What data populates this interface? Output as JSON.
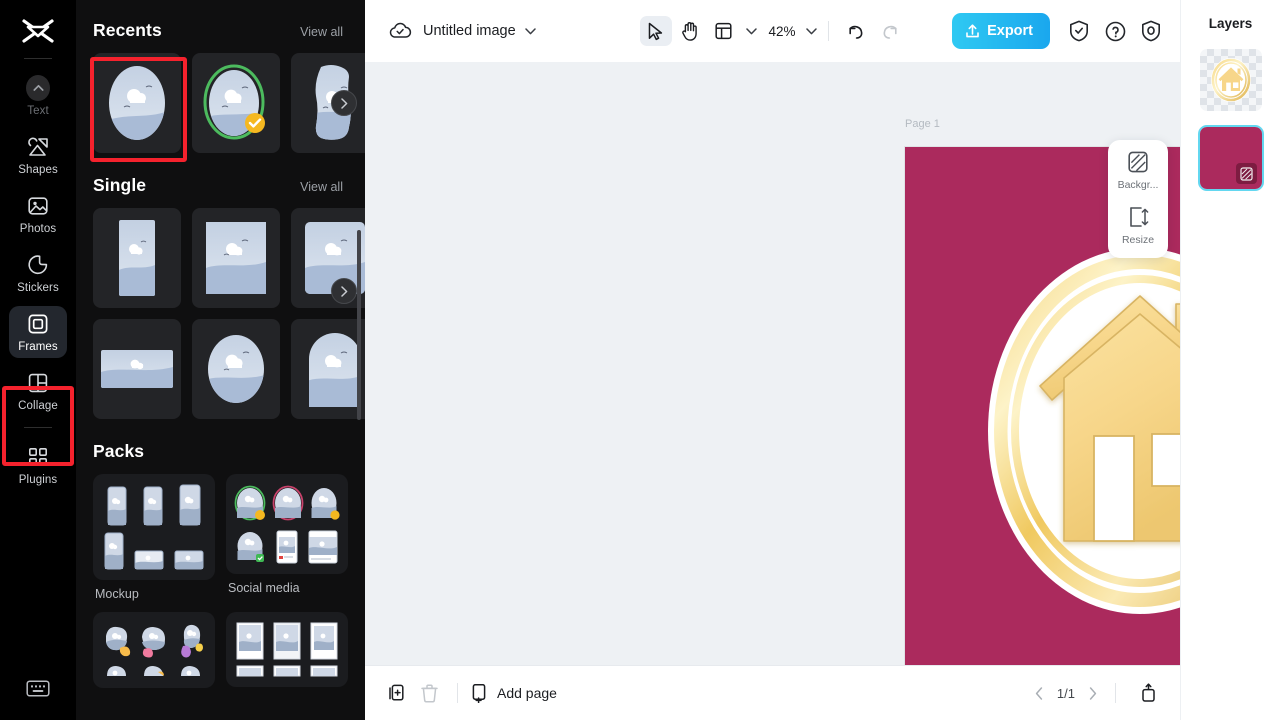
{
  "app": {
    "name": "CapCut",
    "logo_icon": "capcut-logo-icon"
  },
  "sidebar": {
    "items": [
      {
        "label": "Text",
        "icon": "chevron-up-circle-icon",
        "active": false,
        "dim": true
      },
      {
        "label": "Shapes",
        "icon": "shapes-icon",
        "active": false,
        "dim": false
      },
      {
        "label": "Photos",
        "icon": "photo-icon",
        "active": false,
        "dim": false
      },
      {
        "label": "Stickers",
        "icon": "sticker-icon",
        "active": false,
        "dim": false
      },
      {
        "label": "Frames",
        "icon": "frame-icon",
        "active": true,
        "dim": false
      },
      {
        "label": "Collage",
        "icon": "collage-icon",
        "active": false,
        "dim": false
      },
      {
        "label": "Plugins",
        "icon": "plugins-grid-icon",
        "active": false,
        "dim": false
      }
    ],
    "keyboard_icon": "keyboard-icon",
    "highlight_color": "#f5222d"
  },
  "panel": {
    "sections": [
      {
        "title": "Recents",
        "view_all": "View all"
      },
      {
        "title": "Single",
        "view_all": "View all"
      },
      {
        "title": "Packs",
        "view_all": ""
      }
    ],
    "recents": [
      {
        "name": "oval-frame",
        "selected": true,
        "shape": "oval",
        "badge": "none"
      },
      {
        "name": "green-ring-oval-frame",
        "selected": false,
        "shape": "oval",
        "badge": "check",
        "ring": "#4cbb5e",
        "badge_color": "#f5b820"
      },
      {
        "name": "torn-paper-frame",
        "selected": false,
        "shape": "torn",
        "badge": "none"
      }
    ],
    "single": [
      {
        "name": "tall-rect-frame",
        "shape": "tall-rect"
      },
      {
        "name": "wide-rect-frame",
        "shape": "rect"
      },
      {
        "name": "rounded-rect-frame",
        "shape": "rounded-rect"
      },
      {
        "name": "landscape-frame",
        "shape": "landscape"
      },
      {
        "name": "circle-frame",
        "shape": "circle"
      },
      {
        "name": "arch-frame",
        "shape": "arch"
      }
    ],
    "packs": [
      {
        "label": "Mockup",
        "name": "pack-mockup"
      },
      {
        "label": "Social media",
        "name": "pack-social-media"
      },
      {
        "label": "",
        "name": "pack-blob"
      },
      {
        "label": "",
        "name": "pack-polaroid"
      }
    ],
    "next_arrow_icon": "chevron-right-icon",
    "collapse_icon": "chevron-left-icon"
  },
  "topbar": {
    "cloud_icon": "cloud-saved-icon",
    "document_title": "Untitled image",
    "title_caret_icon": "chevron-down-icon",
    "tools": [
      {
        "name": "select-tool",
        "icon": "cursor-arrow-icon",
        "selected": true
      },
      {
        "name": "hand-tool",
        "icon": "hand-icon",
        "selected": false
      },
      {
        "name": "layout-tool",
        "icon": "layout-panel-icon",
        "selected": false
      }
    ],
    "layout_caret_icon": "chevron-down-icon",
    "zoom_level": "42%",
    "zoom_caret_icon": "chevron-down-icon",
    "undo_icon": "undo-icon",
    "redo_icon": "redo-icon",
    "export_label": "Export",
    "export_icon": "upload-icon",
    "export_color": "#1fb6ec",
    "right_icons": [
      {
        "name": "shield-check-icon"
      },
      {
        "name": "help-question-icon"
      },
      {
        "name": "settings-target-icon"
      }
    ]
  },
  "canvas": {
    "page_label": "Page 1",
    "artboard_color": "#ab2a5d",
    "background": "#eef1f4",
    "artwork": {
      "name": "gold-house-coin-emblem",
      "gold_light": "#fadf95",
      "gold_mid": "#f2cf6d",
      "gold_dark": "#d4ad4f",
      "disc_color": "#ffffff"
    },
    "float_panel": [
      {
        "label": "Backgr...",
        "icon": "background-swatch-icon",
        "name": "background-button"
      },
      {
        "label": "Resize",
        "icon": "resize-icon",
        "name": "resize-button"
      }
    ]
  },
  "bottombar": {
    "duplicate_icon": "duplicate-page-icon",
    "delete_icon": "trash-icon",
    "add_page_label": "Add page",
    "add_page_icon": "add-page-icon",
    "prev_icon": "chevron-left-icon",
    "page_indicator": "1/1",
    "next_icon": "chevron-right-icon",
    "expand_icon": "expand-panel-icon"
  },
  "layers": {
    "title": "Layers",
    "items": [
      {
        "name": "layer-house-emblem",
        "type": "image",
        "selected": false
      },
      {
        "name": "layer-background",
        "type": "background",
        "selected": true,
        "color": "#ab2a5d",
        "chip_icon": "background-swatch-icon"
      }
    ]
  }
}
